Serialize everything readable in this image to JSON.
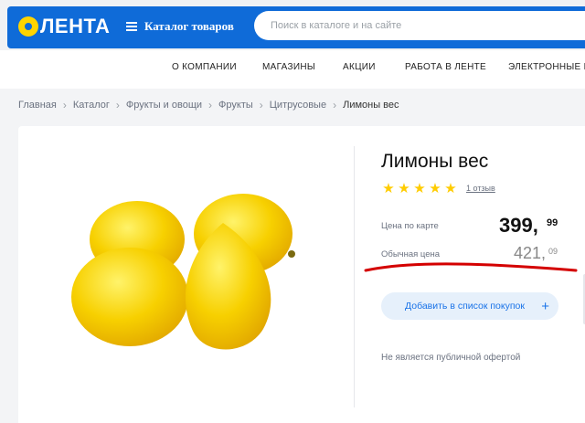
{
  "header": {
    "logo_text": "ЛЕНТА",
    "catalog_label": "Каталог товаров",
    "search_placeholder": "Поиск в каталоге и на сайте"
  },
  "nav": {
    "items": [
      "О КОМПАНИИ",
      "МАГАЗИНЫ",
      "АКЦИИ",
      "РАБОТА В ЛЕНТЕ",
      "ЭЛЕКТРОННЫЕ КА"
    ]
  },
  "breadcrumbs": {
    "items": [
      "Главная",
      "Каталог",
      "Фрукты и овощи",
      "Фрукты",
      "Цитрусовые"
    ],
    "current": "Лимоны вес"
  },
  "product": {
    "title": "Лимоны вес",
    "rating": 5,
    "reviews": "1 отзыв",
    "card_price_label": "Цена по карте",
    "card_price_main": "399,",
    "card_price_cents": "99",
    "regular_price_label": "Обычная цена",
    "regular_price_main": "421,",
    "regular_price_cents": "09",
    "add_button_label": "Добавить в список покупок",
    "offer_note": "Не является публичной офертой"
  },
  "colors": {
    "brand_blue": "#0f6bd8",
    "star": "#ffcc00",
    "annotation_red": "#d40000"
  },
  "icons": {
    "star": "star-icon",
    "plus": "plus-icon",
    "menu": "burger-menu-icon",
    "chevron": "chevron-right-icon"
  }
}
